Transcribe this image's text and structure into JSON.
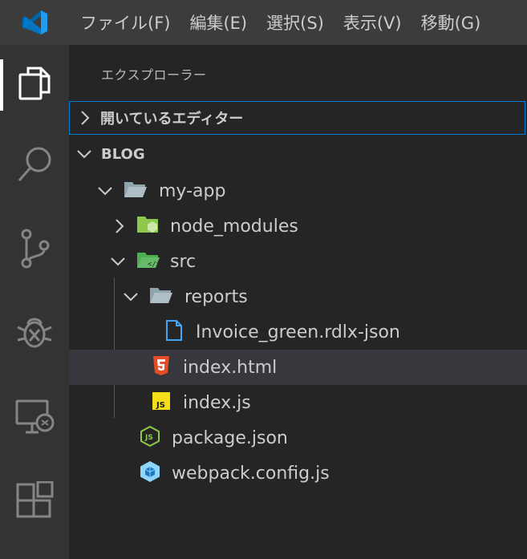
{
  "menubar": {
    "items": [
      "ファイル(F)",
      "編集(E)",
      "選択(S)",
      "表示(V)",
      "移動(G)"
    ]
  },
  "activitybar": {
    "icons": [
      "files-icon",
      "search-icon",
      "source-control-icon",
      "debug-icon",
      "remote-explorer-icon",
      "extensions-icon"
    ]
  },
  "sidebar": {
    "title": "エクスプローラー",
    "open_editors_label": "開いているエディター",
    "folder_label": "BLOG",
    "tree": [
      {
        "label": "my-app",
        "kind": "folder-open"
      },
      {
        "label": "node_modules",
        "kind": "folder-node"
      },
      {
        "label": "src",
        "kind": "folder-src"
      },
      {
        "label": "reports",
        "kind": "folder-open"
      },
      {
        "label": "Invoice_green.rdlx-json",
        "kind": "file"
      },
      {
        "label": "index.html",
        "kind": "html"
      },
      {
        "label": "index.js",
        "kind": "js"
      },
      {
        "label": "package.json",
        "kind": "package"
      },
      {
        "label": "webpack.config.js",
        "kind": "webpack"
      }
    ]
  },
  "colors": {
    "accent": "#007fd4",
    "selected_row": "#37373d",
    "html_icon": "#e44d26",
    "js_icon": "#f5de19",
    "node_green": "#8cc84b",
    "webpack_blue": "#8ed6fb"
  }
}
